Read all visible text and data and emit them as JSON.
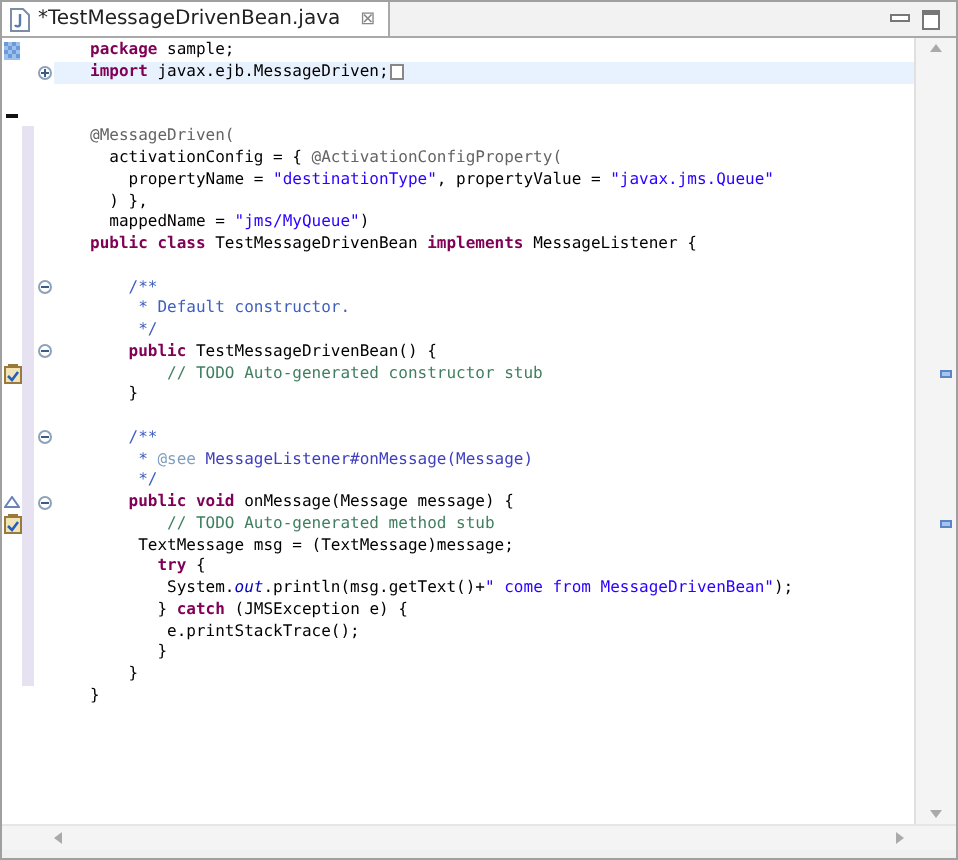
{
  "tab": {
    "title": "*TestMessageDrivenBean.java",
    "selected": true,
    "close": "⊠"
  },
  "lines": [
    {
      "segments": [
        {
          "text": "package",
          "kind": "keyword"
        },
        {
          "text": " sample;",
          "kind": "code"
        }
      ],
      "markers": [
        {
          "kind": "search"
        }
      ],
      "changed": false,
      "current": false
    },
    {
      "segments": [
        {
          "text": "import",
          "kind": "keyword"
        },
        {
          "text": " javax.ejb.MessageDriven;",
          "kind": "code"
        }
      ],
      "fold": {
        "expanded": false
      },
      "changed": false,
      "current": true
    },
    {
      "changed": false,
      "current": false
    },
    {
      "markers": [
        {
          "kind": "dash"
        }
      ],
      "changed": false,
      "current": false
    },
    {
      "segments": [
        {
          "text": "@MessageDriven(",
          "kind": "annotation"
        }
      ],
      "changed": true,
      "current": false
    },
    {
      "segments": [
        {
          "text": "  activationConfig = { ",
          "kind": "code"
        },
        {
          "text": "@ActivationConfigProperty(",
          "kind": "annotation"
        }
      ],
      "changed": true,
      "current": false
    },
    {
      "segments": [
        {
          "text": "    propertyName = ",
          "kind": "code"
        },
        {
          "text": "\"destinationType\"",
          "kind": "string"
        },
        {
          "text": ", propertyValue = ",
          "kind": "code"
        },
        {
          "text": "\"javax.jms.Queue\"",
          "kind": "string"
        }
      ],
      "changed": true,
      "current": false
    },
    {
      "segments": [
        {
          "text": "  ) },",
          "kind": "code"
        }
      ],
      "changed": true,
      "current": false
    },
    {
      "segments": [
        {
          "text": "  mappedName = ",
          "kind": "code"
        },
        {
          "text": "\"jms/MyQueue\"",
          "kind": "string"
        },
        {
          "text": ")",
          "kind": "code"
        }
      ],
      "changed": true,
      "current": false
    },
    {
      "segments": [
        {
          "text": "public class",
          "kind": "keyword"
        },
        {
          "text": " TestMessageDrivenBean ",
          "kind": "code"
        },
        {
          "text": "implements",
          "kind": "keyword"
        },
        {
          "text": " MessageListener {",
          "kind": "code"
        }
      ],
      "changed": true,
      "current": false
    },
    {
      "changed": true,
      "current": false
    },
    {
      "segments": [
        {
          "text": "    /**",
          "kind": "javadoc"
        }
      ],
      "fold": {
        "expanded": true
      },
      "changed": true,
      "current": false
    },
    {
      "segments": [
        {
          "text": "     * Default constructor.",
          "kind": "javadoc"
        }
      ],
      "changed": true,
      "current": false
    },
    {
      "segments": [
        {
          "text": "     */",
          "kind": "javadoc"
        }
      ],
      "changed": true,
      "current": false
    },
    {
      "segments": [
        {
          "text": "    public",
          "kind": "keyword"
        },
        {
          "text": " TestMessageDrivenBean() {",
          "kind": "code"
        }
      ],
      "fold": {
        "expanded": true
      },
      "changed": true,
      "current": false
    },
    {
      "segments": [
        {
          "text": "        // TODO Auto-generated constructor stub",
          "kind": "comment"
        }
      ],
      "markers": [
        {
          "kind": "task"
        }
      ],
      "changed": true,
      "current": false
    },
    {
      "segments": [
        {
          "text": "    }",
          "kind": "code"
        }
      ],
      "changed": true,
      "current": false
    },
    {
      "changed": true,
      "current": false
    },
    {
      "segments": [
        {
          "text": "    /**",
          "kind": "javadoc"
        }
      ],
      "fold": {
        "expanded": true
      },
      "changed": true,
      "current": false
    },
    {
      "segments": [
        {
          "text": "     * ",
          "kind": "javadoc"
        },
        {
          "text": "@see",
          "kind": "javadoc_tag"
        },
        {
          "text": " MessageListener#onMessage(Message)",
          "kind": "javadoc_link"
        }
      ],
      "changed": true,
      "current": false
    },
    {
      "segments": [
        {
          "text": "     */",
          "kind": "javadoc"
        }
      ],
      "changed": true,
      "current": false
    },
    {
      "segments": [
        {
          "text": "    public void",
          "kind": "keyword"
        },
        {
          "text": " onMessage(Message message) {",
          "kind": "code"
        }
      ],
      "fold": {
        "expanded": true
      },
      "markers": [
        {
          "kind": "override"
        }
      ],
      "changed": true,
      "current": false
    },
    {
      "segments": [
        {
          "text": "        // TODO Auto-generated method stub",
          "kind": "comment"
        }
      ],
      "markers": [
        {
          "kind": "task"
        }
      ],
      "changed": true,
      "current": false
    },
    {
      "segments": [
        {
          "text": "     TextMessage msg = (TextMessage)message;",
          "kind": "code"
        }
      ],
      "changed": true,
      "current": false
    },
    {
      "segments": [
        {
          "text": "       try",
          "kind": "keyword"
        },
        {
          "text": " {",
          "kind": "code"
        }
      ],
      "changed": true,
      "current": false
    },
    {
      "segments": [
        {
          "text": "        System.",
          "kind": "code"
        },
        {
          "text": "out",
          "kind": "static_field"
        },
        {
          "text": ".println(msg.getText()+",
          "kind": "code"
        },
        {
          "text": "\" come from MessageDrivenBean\"",
          "kind": "string"
        },
        {
          "text": ");",
          "kind": "code"
        }
      ],
      "changed": true,
      "current": false
    },
    {
      "segments": [
        {
          "text": "       } ",
          "kind": "code"
        },
        {
          "text": "catch",
          "kind": "keyword"
        },
        {
          "text": " (JMSException e) {",
          "kind": "code"
        }
      ],
      "changed": true,
      "current": false
    },
    {
      "segments": [
        {
          "text": "        e.printStackTrace();",
          "kind": "code"
        }
      ],
      "changed": true,
      "current": false
    },
    {
      "segments": [
        {
          "text": "       }",
          "kind": "code"
        }
      ],
      "changed": true,
      "current": false
    },
    {
      "segments": [
        {
          "text": "    }",
          "kind": "code"
        }
      ],
      "changed": true,
      "current": false
    },
    {
      "segments": [
        {
          "text": "}",
          "kind": "code"
        }
      ],
      "changed": false,
      "current": false
    }
  ]
}
